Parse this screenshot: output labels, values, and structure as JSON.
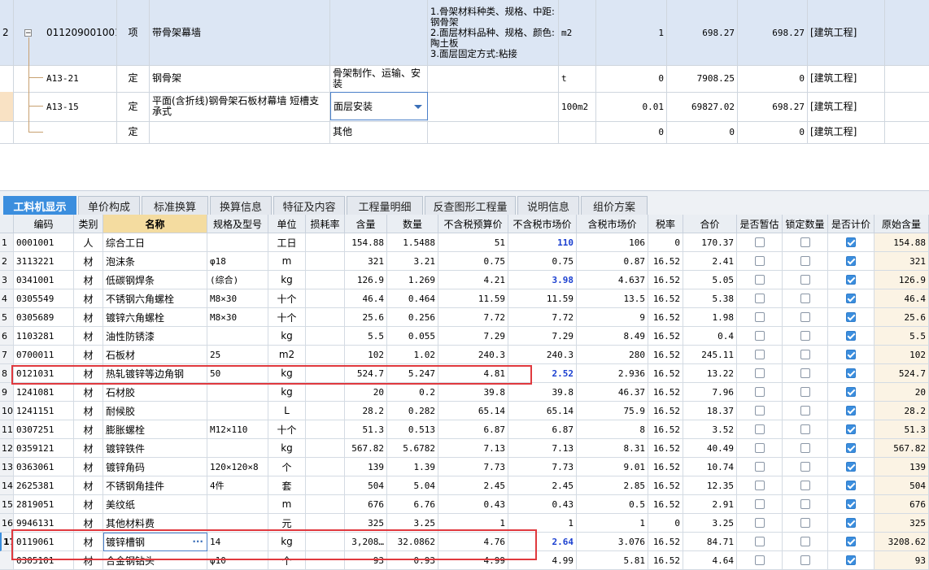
{
  "top": {
    "rows": [
      {
        "no": "2",
        "code": "011209001001",
        "type": "项",
        "name": "带骨架幕墙",
        "work": "",
        "feature": "1.骨架材料种类、规格、中距:钢骨架\n2.面层材料品种、规格、颜色:陶土板\n3.面层固定方式:粘接",
        "unit": "m2",
        "qty": "1",
        "price": "698.27",
        "total": "698.27",
        "cat": "[建筑工程]"
      },
      {
        "no": "",
        "code": "A13-21",
        "type": "定",
        "name": "钢骨架",
        "work": "骨架制作、运输、安装",
        "feature": "",
        "unit": "t",
        "qty": "0",
        "price": "7908.25",
        "total": "0",
        "cat": "[建筑工程]"
      },
      {
        "no": "",
        "code": "A13-15",
        "type": "定",
        "name": "平面(含折线)钢骨架石板材幕墙 短槽支承式",
        "work": "面层安装",
        "feature": "",
        "unit": "100m2",
        "qty": "0.01",
        "price": "69827.02",
        "total": "698.27",
        "cat": "[建筑工程]"
      },
      {
        "no": "",
        "code": "",
        "type": "定",
        "name": "",
        "work": "其他",
        "feature": "",
        "unit": "",
        "qty": "0",
        "price": "0",
        "total": "0",
        "cat": "[建筑工程]"
      }
    ]
  },
  "tabs": [
    "工料机显示",
    "单价构成",
    "标准换算",
    "换算信息",
    "特征及内容",
    "工程量明细",
    "反查图形工程量",
    "说明信息",
    "组价方案"
  ],
  "headers": [
    "编码",
    "类别",
    "名称",
    "规格及型号",
    "单位",
    "损耗率",
    "含量",
    "数量",
    "不含税预算价",
    "不含税市场价",
    "含税市场价",
    "税率",
    "合价",
    "是否暂估",
    "锁定数量",
    "是否计价",
    "原始含量"
  ],
  "rows": [
    {
      "i": "1",
      "code": "0001001",
      "cat": "人",
      "name": "综合工日",
      "spec": "",
      "unit": "工日",
      "loss": "",
      "content": "154.88",
      "qty": "1.5488",
      "budget": "51",
      "market": "110",
      "market_hl": true,
      "tax_market": "106",
      "rate": "0",
      "amount": "170.37",
      "est": false,
      "lock": false,
      "priced": true,
      "orig": "154.88"
    },
    {
      "i": "2",
      "code": "3113221",
      "cat": "材",
      "name": "泡沫条",
      "spec": "φ18",
      "unit": "m",
      "loss": "",
      "content": "321",
      "qty": "3.21",
      "budget": "0.75",
      "market": "0.75",
      "market_hl": false,
      "tax_market": "0.87",
      "rate": "16.52",
      "amount": "2.41",
      "est": false,
      "lock": false,
      "priced": true,
      "orig": "321"
    },
    {
      "i": "3",
      "code": "0341001",
      "cat": "材",
      "name": "低碳钢焊条",
      "spec": "(综合)",
      "unit": "kg",
      "loss": "",
      "content": "126.9",
      "qty": "1.269",
      "budget": "4.21",
      "market": "3.98",
      "market_hl": true,
      "tax_market": "4.637",
      "rate": "16.52",
      "amount": "5.05",
      "est": false,
      "lock": false,
      "priced": true,
      "orig": "126.9"
    },
    {
      "i": "4",
      "code": "0305549",
      "cat": "材",
      "name": "不锈钢六角螺栓",
      "spec": "M8×30",
      "unit": "十个",
      "loss": "",
      "content": "46.4",
      "qty": "0.464",
      "budget": "11.59",
      "market": "11.59",
      "market_hl": false,
      "tax_market": "13.5",
      "rate": "16.52",
      "amount": "5.38",
      "est": false,
      "lock": false,
      "priced": true,
      "orig": "46.4"
    },
    {
      "i": "5",
      "code": "0305689",
      "cat": "材",
      "name": "镀锌六角螺栓",
      "spec": "M8×30",
      "unit": "十个",
      "loss": "",
      "content": "25.6",
      "qty": "0.256",
      "budget": "7.72",
      "market": "7.72",
      "market_hl": false,
      "tax_market": "9",
      "rate": "16.52",
      "amount": "1.98",
      "est": false,
      "lock": false,
      "priced": true,
      "orig": "25.6"
    },
    {
      "i": "6",
      "code": "1103281",
      "cat": "材",
      "name": "油性防锈漆",
      "spec": "",
      "unit": "kg",
      "loss": "",
      "content": "5.5",
      "qty": "0.055",
      "budget": "7.29",
      "market": "7.29",
      "market_hl": false,
      "tax_market": "8.49",
      "rate": "16.52",
      "amount": "0.4",
      "est": false,
      "lock": false,
      "priced": true,
      "orig": "5.5"
    },
    {
      "i": "7",
      "code": "0700011",
      "cat": "材",
      "name": "石板材",
      "spec": "25",
      "unit": "m2",
      "loss": "",
      "content": "102",
      "qty": "1.02",
      "budget": "240.3",
      "market": "240.3",
      "market_hl": false,
      "tax_market": "280",
      "rate": "16.52",
      "amount": "245.11",
      "est": false,
      "lock": false,
      "priced": true,
      "orig": "102"
    },
    {
      "i": "8",
      "code": "0121031",
      "cat": "材",
      "name": "热轧镀锌等边角钢",
      "spec": "50",
      "unit": "kg",
      "loss": "",
      "content": "524.7",
      "qty": "5.247",
      "budget": "4.81",
      "market": "2.52",
      "market_hl": true,
      "tax_market": "2.936",
      "rate": "16.52",
      "amount": "13.22",
      "est": false,
      "lock": false,
      "priced": true,
      "orig": "524.7"
    },
    {
      "i": "9",
      "code": "1241081",
      "cat": "材",
      "name": "石材胶",
      "spec": "",
      "unit": "kg",
      "loss": "",
      "content": "20",
      "qty": "0.2",
      "budget": "39.8",
      "market": "39.8",
      "market_hl": false,
      "tax_market": "46.37",
      "rate": "16.52",
      "amount": "7.96",
      "est": false,
      "lock": false,
      "priced": true,
      "orig": "20"
    },
    {
      "i": "10",
      "code": "1241151",
      "cat": "材",
      "name": "耐候胶",
      "spec": "",
      "unit": "L",
      "loss": "",
      "content": "28.2",
      "qty": "0.282",
      "budget": "65.14",
      "market": "65.14",
      "market_hl": false,
      "tax_market": "75.9",
      "rate": "16.52",
      "amount": "18.37",
      "est": false,
      "lock": false,
      "priced": true,
      "orig": "28.2"
    },
    {
      "i": "11",
      "code": "0307251",
      "cat": "材",
      "name": "膨胀螺栓",
      "spec": "M12×110",
      "unit": "十个",
      "loss": "",
      "content": "51.3",
      "qty": "0.513",
      "budget": "6.87",
      "market": "6.87",
      "market_hl": false,
      "tax_market": "8",
      "rate": "16.52",
      "amount": "3.52",
      "est": false,
      "lock": false,
      "priced": true,
      "orig": "51.3"
    },
    {
      "i": "12",
      "code": "0359121",
      "cat": "材",
      "name": "镀锌铁件",
      "spec": "",
      "unit": "kg",
      "loss": "",
      "content": "567.82",
      "qty": "5.6782",
      "budget": "7.13",
      "market": "7.13",
      "market_hl": false,
      "tax_market": "8.31",
      "rate": "16.52",
      "amount": "40.49",
      "est": false,
      "lock": false,
      "priced": true,
      "orig": "567.82"
    },
    {
      "i": "13",
      "code": "0363061",
      "cat": "材",
      "name": "镀锌角码",
      "spec": "120×120×8",
      "unit": "个",
      "loss": "",
      "content": "139",
      "qty": "1.39",
      "budget": "7.73",
      "market": "7.73",
      "market_hl": false,
      "tax_market": "9.01",
      "rate": "16.52",
      "amount": "10.74",
      "est": false,
      "lock": false,
      "priced": true,
      "orig": "139"
    },
    {
      "i": "14",
      "code": "2625381",
      "cat": "材",
      "name": "不锈钢角挂件",
      "spec": "4件",
      "unit": "套",
      "loss": "",
      "content": "504",
      "qty": "5.04",
      "budget": "2.45",
      "market": "2.45",
      "market_hl": false,
      "tax_market": "2.85",
      "rate": "16.52",
      "amount": "12.35",
      "est": false,
      "lock": false,
      "priced": true,
      "orig": "504"
    },
    {
      "i": "15",
      "code": "2819051",
      "cat": "材",
      "name": "美纹纸",
      "spec": "",
      "unit": "m",
      "loss": "",
      "content": "676",
      "qty": "6.76",
      "budget": "0.43",
      "market": "0.43",
      "market_hl": false,
      "tax_market": "0.5",
      "rate": "16.52",
      "amount": "2.91",
      "est": false,
      "lock": false,
      "priced": true,
      "orig": "676"
    },
    {
      "i": "16",
      "code": "9946131",
      "cat": "材",
      "name": "其他材料费",
      "spec": "",
      "unit": "元",
      "loss": "",
      "content": "325",
      "qty": "3.25",
      "budget": "1",
      "market": "1",
      "market_hl": false,
      "tax_market": "1",
      "rate": "0",
      "amount": "3.25",
      "est": false,
      "lock": false,
      "priced": true,
      "orig": "325"
    },
    {
      "i": "17",
      "code": "0119061",
      "cat": "材",
      "name": "镀锌槽钢",
      "spec": "14",
      "unit": "kg",
      "loss": "",
      "content": "3,208…",
      "qty": "32.0862",
      "budget": "4.76",
      "market": "2.64",
      "market_hl": true,
      "tax_market": "3.076",
      "rate": "16.52",
      "amount": "84.71",
      "est": false,
      "lock": false,
      "priced": true,
      "orig": "3208.62"
    },
    {
      "i": "",
      "code": "0305101",
      "cat": "材",
      "name": "合金钢钻头",
      "spec": "φ10",
      "unit": "个",
      "loss": "",
      "content": "93",
      "qty": "0.93",
      "budget": "4.99",
      "market": "4.99",
      "market_hl": false,
      "tax_market": "5.81",
      "rate": "16.52",
      "amount": "4.64",
      "est": false,
      "lock": false,
      "priced": true,
      "orig": "93"
    }
  ],
  "colors": {
    "accent": "#3b8ede",
    "highlight": "#e0393e",
    "value_blue": "#1a3fd0",
    "name_header": "#f4dca0"
  }
}
